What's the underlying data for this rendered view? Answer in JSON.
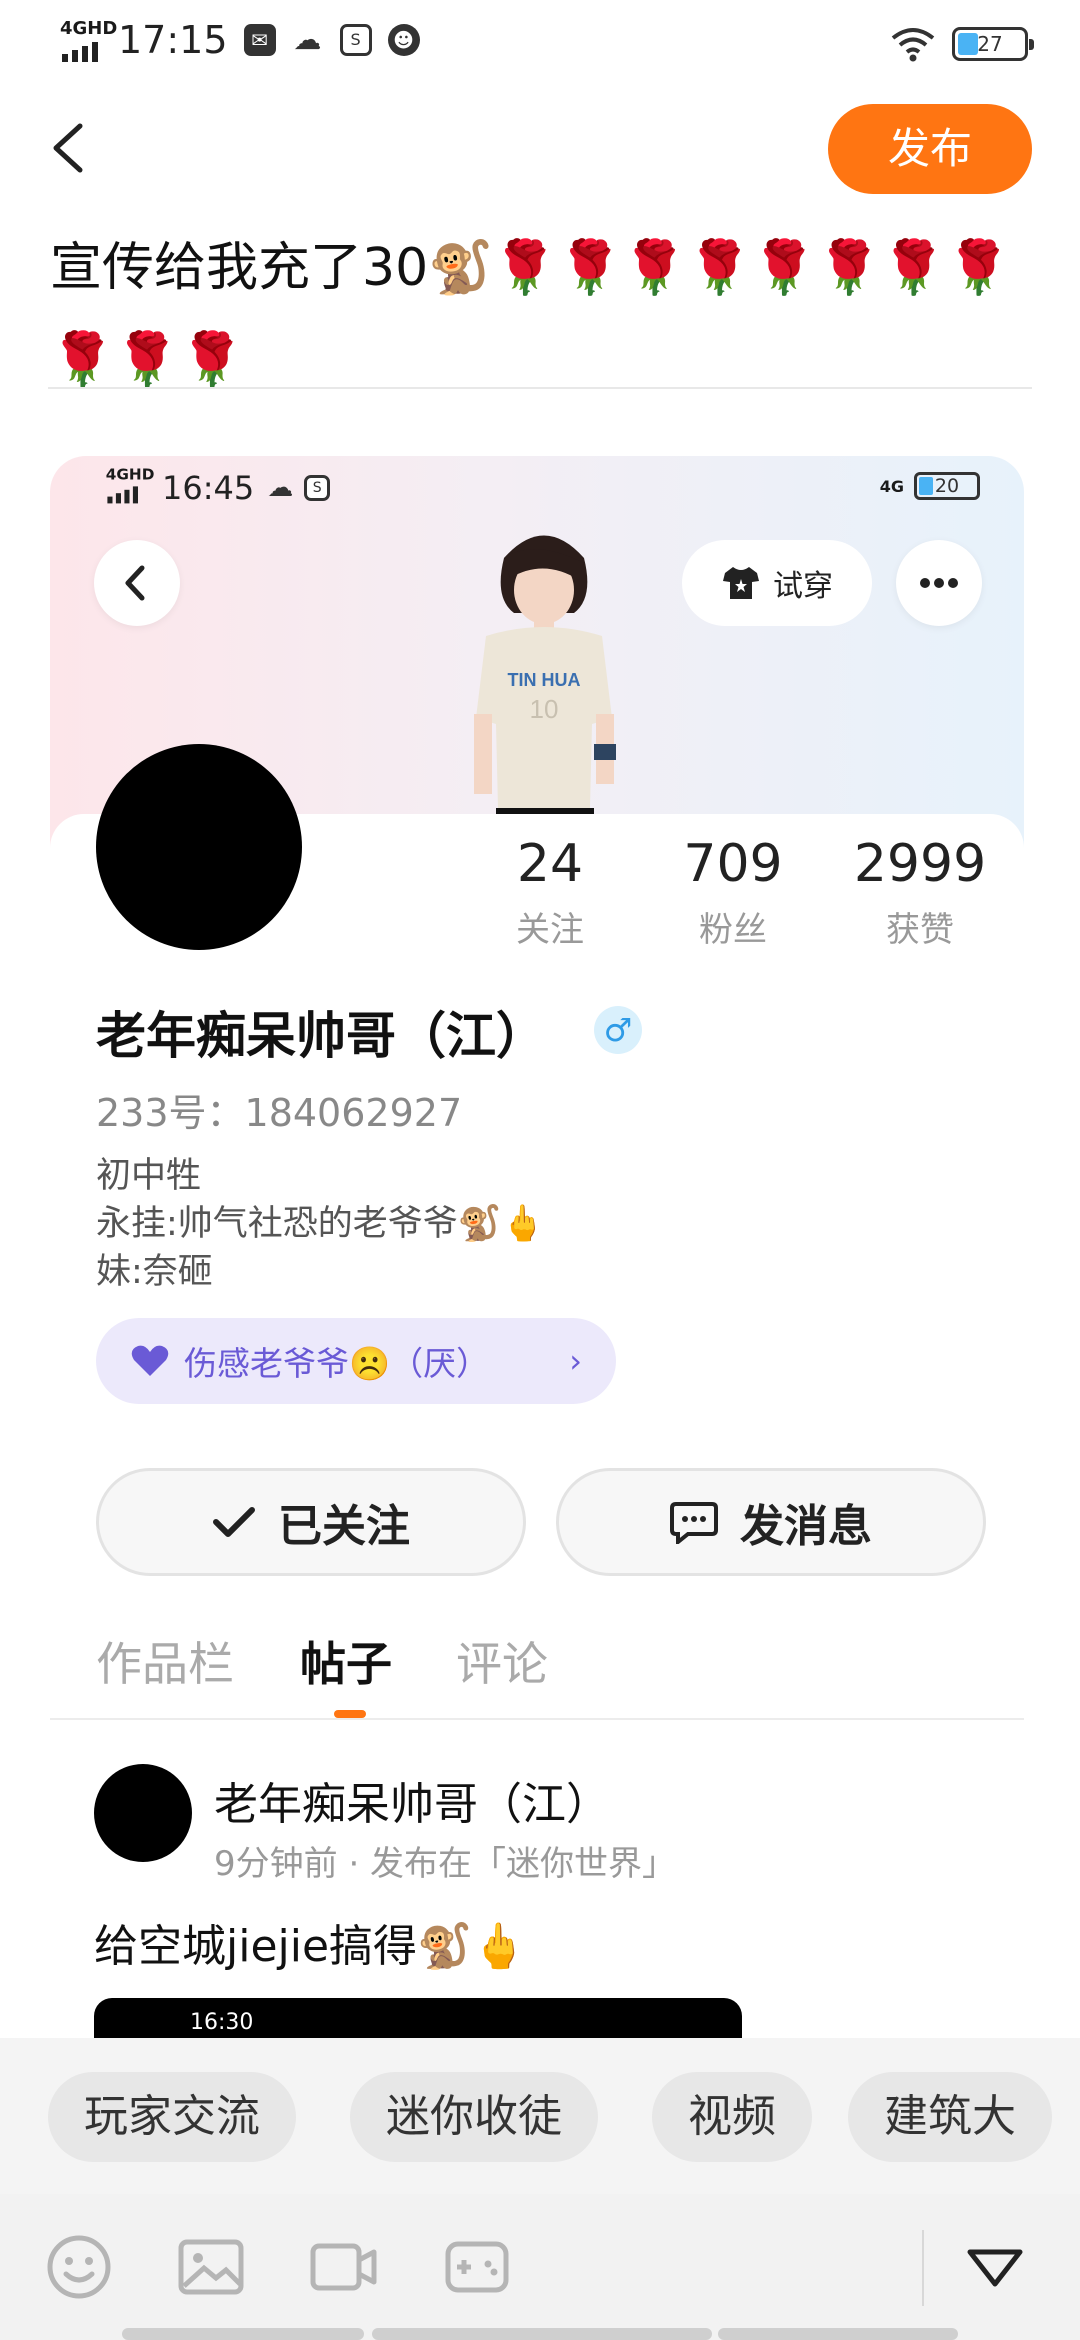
{
  "status_bar": {
    "network": "4GHD",
    "time": "17:15",
    "battery": "27",
    "icons": [
      "message-icon",
      "wechat-icon",
      "screenshot-icon",
      "robot-icon",
      "wifi-icon",
      "battery-icon"
    ]
  },
  "header": {
    "back_icon": "chevron-left-icon",
    "publish_label": "发布"
  },
  "post_text": "宣传给我充了30🐒🌹🌹🌹🌹🌹🌹🌹🌹🌹🌹🌹",
  "screenshot": {
    "status_network": "4GHD",
    "status_time": "16:45",
    "status_signal": "4G",
    "battery": "20",
    "try_on_label": "试穿",
    "stats": [
      {
        "value": "24",
        "label": "关注"
      },
      {
        "value": "709",
        "label": "粉丝"
      },
      {
        "value": "2999",
        "label": "获赞"
      }
    ],
    "name": "老年痴呆帅哥（江）",
    "gender_symbol": "♂",
    "uid_line": "233号：184062927",
    "bio": [
      "初中牲",
      "永挂:帅气社恐的老爷爷🐒🖕",
      "妹:奈砸"
    ],
    "tag_label": "伤感老爷爷☹️（厌）",
    "tag_arrow": "›",
    "followed_label": "已关注",
    "message_label": "发消息",
    "tabs": [
      "作品栏",
      "帖子",
      "评论"
    ],
    "active_tab": 1,
    "post": {
      "author": "老年痴呆帅哥（江）",
      "meta": "9分钟前 · 发布在「迷你世界」",
      "content": "给空城jiejie搞得🐒🖕",
      "thumb_time": "16:30"
    }
  },
  "topics": [
    "玩家交流",
    "迷你收徒",
    "视频",
    "建筑大"
  ],
  "toolbar_icons": [
    "emoji-icon",
    "image-icon",
    "video-icon",
    "gamepad-icon",
    "collapse-icon"
  ],
  "colors": {
    "accent": "#ff7512",
    "tag_bg": "#ece9fb",
    "tag_text": "#6a5ad6"
  }
}
